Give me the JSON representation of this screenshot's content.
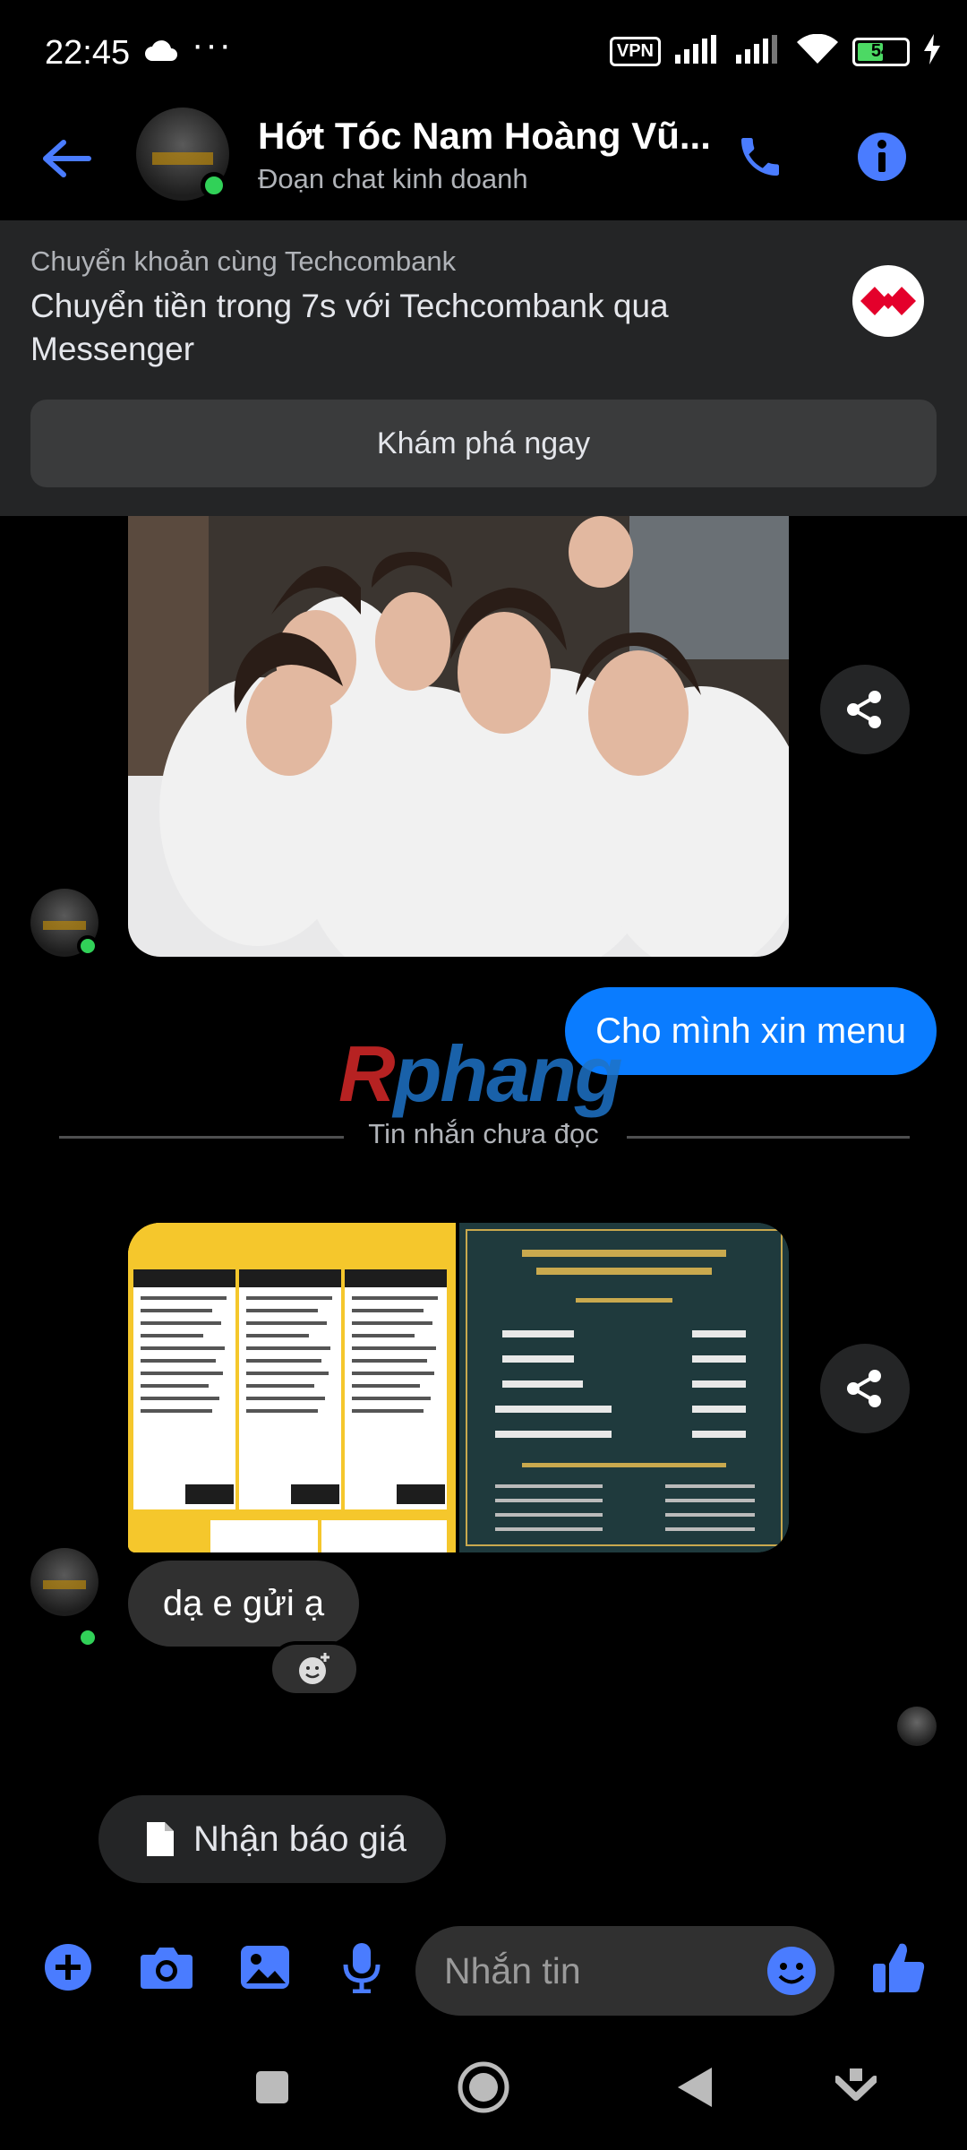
{
  "status_bar": {
    "time": "22:45",
    "more": "···",
    "vpn": "VPN",
    "battery": "54",
    "battery_level": 0.54
  },
  "header": {
    "name": "Hớt Tóc Nam Hoàng Vũ...",
    "subtitle": "Đoạn chat kinh doanh"
  },
  "promo": {
    "kicker": "Chuyển khoản cùng Techcombank",
    "title": "Chuyển tiền trong 7s với Techcombank qua Messenger",
    "button": "Khám phá ngay",
    "brand_color": "#e4002b"
  },
  "messages": {
    "outgoing_1": "Cho mình xin menu",
    "incoming_1": "dạ e gửi ạ"
  },
  "divider": {
    "label": "Tin nhắn chưa đọc"
  },
  "watermark": {
    "part1": "R",
    "part2": "phang"
  },
  "quick_reply": {
    "label": "Nhận báo giá"
  },
  "composer": {
    "placeholder": "Nhắn tin"
  },
  "colors": {
    "accent": "#0a7cff",
    "icon_blue": "#4a7cff",
    "online": "#31d158"
  }
}
